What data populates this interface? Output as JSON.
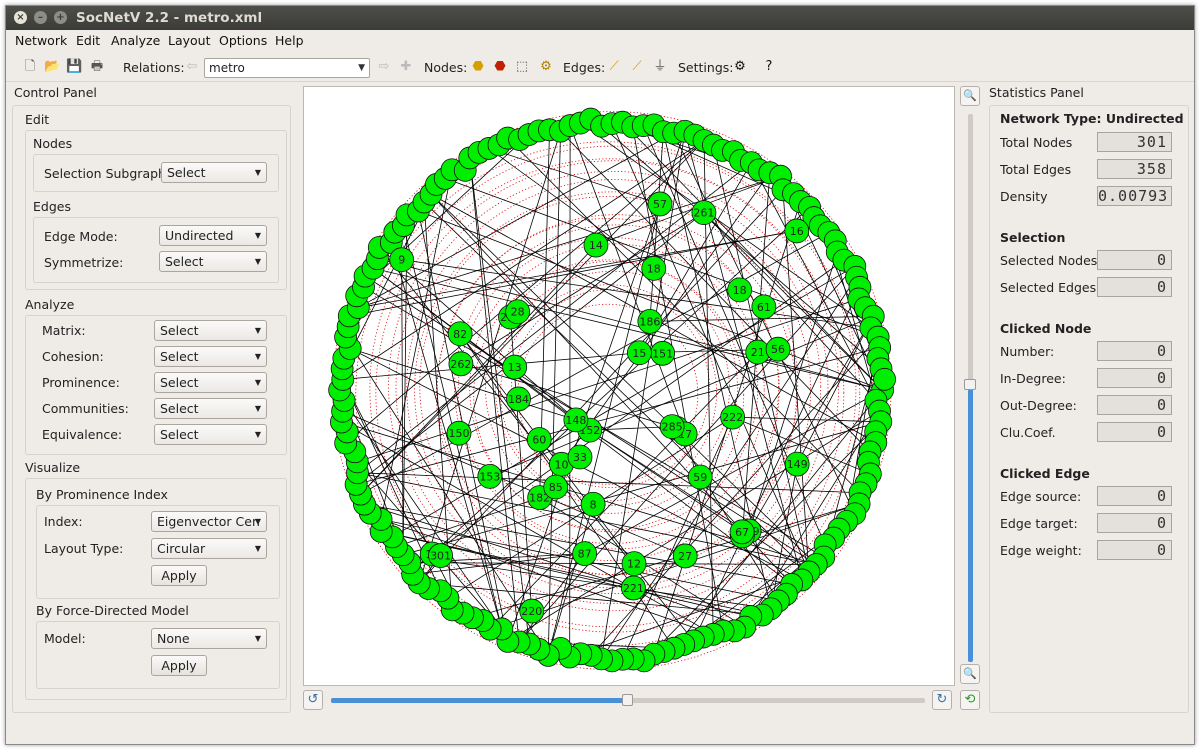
{
  "window": {
    "title": "SocNetV 2.2 - metro.xml"
  },
  "menu": [
    "Network",
    "Edit",
    "Analyze",
    "Layout",
    "Options",
    "Help"
  ],
  "toolbar": {
    "relations_label": "Relations:",
    "relation_value": "metro",
    "nodes_label": "Nodes:",
    "edges_label": "Edges:",
    "settings_label": "Settings:"
  },
  "control": {
    "title": "Control Panel",
    "edit": "Edit",
    "nodes": "Nodes",
    "selection_subgraph": "Selection Subgraph:",
    "select": "Select",
    "edges": "Edges",
    "edge_mode": "Edge Mode:",
    "edge_mode_value": "Undirected",
    "symmetrize": "Symmetrize:",
    "analyze": "Analyze",
    "matrix": "Matrix:",
    "cohesion": "Cohesion:",
    "prominence": "Prominence:",
    "communities": "Communities:",
    "equivalence": "Equivalence:",
    "visualize": "Visualize",
    "by_prominence": "By Prominence Index",
    "index": "Index:",
    "index_value": "Eigenvector Cen",
    "layout_type": "Layout Type:",
    "layout_value": "Circular",
    "apply": "Apply",
    "by_force": "By Force-Directed Model",
    "model": "Model:",
    "model_value": "None"
  },
  "stats": {
    "title": "Statistics Panel",
    "network_type": "Network Type: Undirected",
    "total_nodes_label": "Total Nodes",
    "total_nodes": "301",
    "total_edges_label": "Total Edges",
    "total_edges": "358",
    "density_label": "Density",
    "density": "0.00793",
    "selection": "Selection",
    "selected_nodes_label": "Selected Nodes",
    "selected_nodes": "0",
    "selected_edges_label": "Selected Edges",
    "selected_edges": "0",
    "clicked_node": "Clicked Node",
    "number_label": "Number:",
    "number": "0",
    "indegree_label": "In-Degree:",
    "indegree": "0",
    "outdegree_label": "Out-Degree:",
    "outdegree": "0",
    "clucoef_label": "Clu.Coef.",
    "clucoef": "0",
    "clicked_edge": "Clicked Edge",
    "edge_source_label": "Edge source:",
    "edge_source": "0",
    "edge_target_label": "Edge target:",
    "edge_target": "0",
    "edge_weight_label": "Edge weight:",
    "edge_weight": "0"
  },
  "graph": {
    "labeled_nodes": [
      "21",
      "222",
      "27",
      "221",
      "220",
      "219",
      "186",
      "182",
      "18",
      "185",
      "184",
      "153",
      "152",
      "149",
      "150",
      "151",
      "60",
      "148",
      "139",
      "15",
      "13",
      "10",
      "14",
      "12",
      "16",
      "19",
      "18",
      "17",
      "20",
      "9",
      "8",
      "33",
      "61",
      "57",
      "87",
      "67",
      "56",
      "85",
      "82",
      "59",
      "261",
      "262",
      "28",
      "285",
      "301"
    ],
    "node_color": "#00ee00",
    "edge_color": "#000000",
    "ring_color": "#e00000"
  },
  "zoom": {
    "in": "zoom-in",
    "out": "zoom-out"
  }
}
